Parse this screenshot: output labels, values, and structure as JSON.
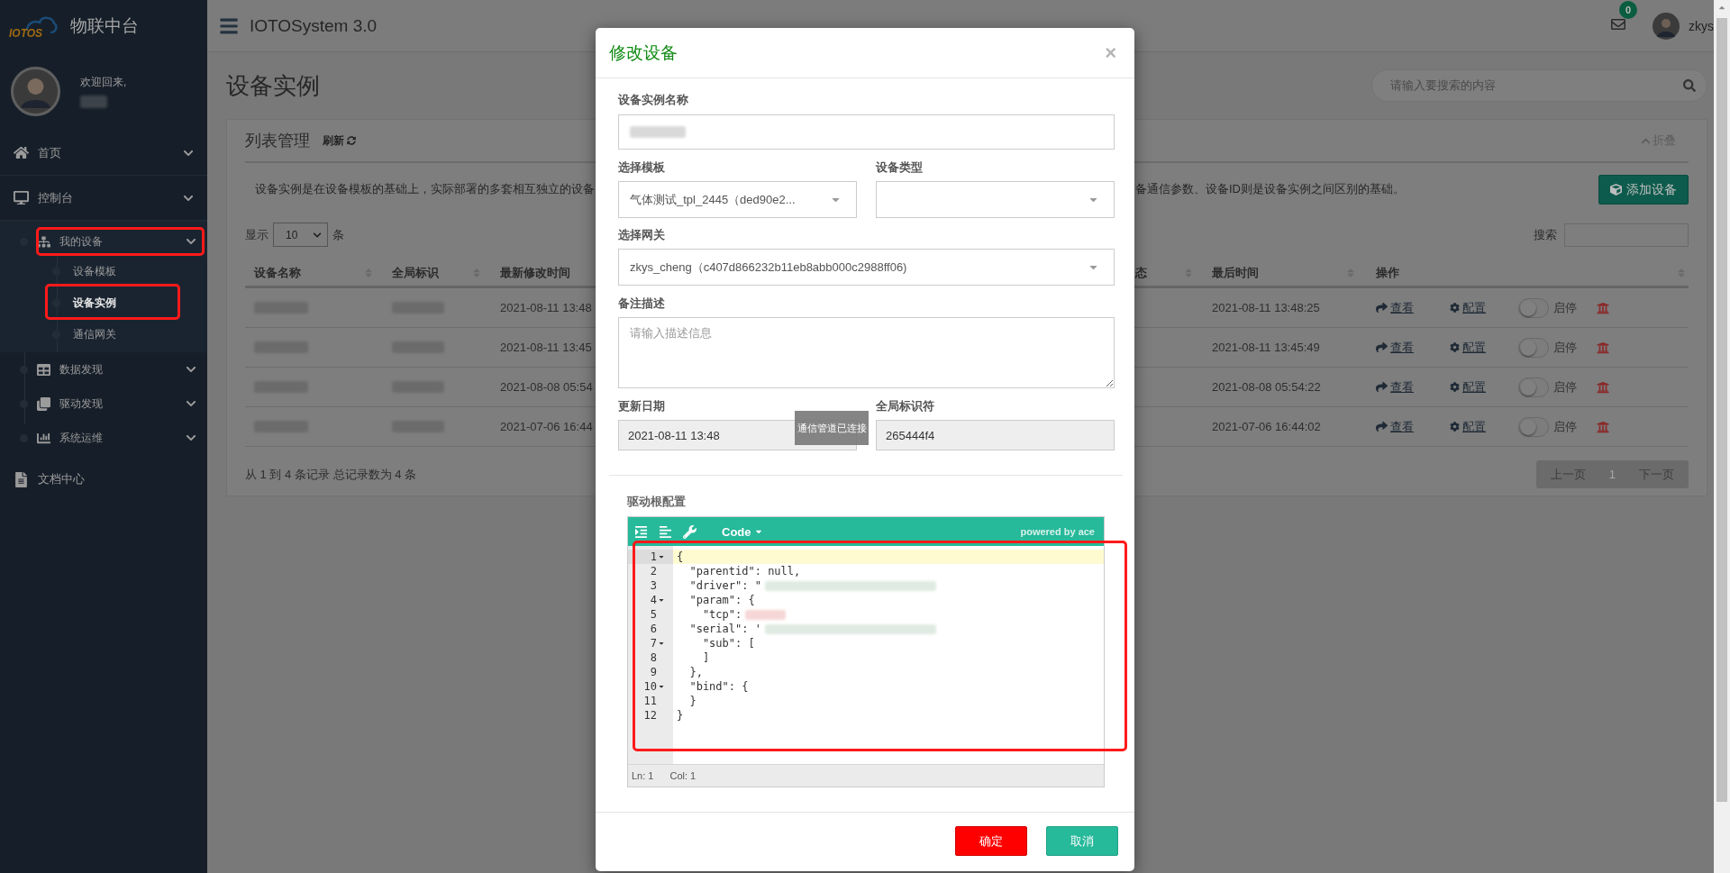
{
  "sidebar": {
    "logo_text": "IOTOS",
    "title": "物联中台",
    "welcome": "欢迎回来,",
    "user_redacted": true,
    "items": [
      {
        "label": "首页",
        "kind": "menu",
        "selected": false
      },
      {
        "label": "控制台",
        "kind": "menu",
        "selected": false,
        "expanded": true,
        "children": [
          {
            "label": "我的设备",
            "kind": "menu",
            "selected": false,
            "expanded": true,
            "highlighted": true,
            "children": [
              {
                "label": "设备模板",
                "selected": false,
                "highlighted": false
              },
              {
                "label": "设备实例",
                "selected": true,
                "highlighted": true
              },
              {
                "label": "通信网关",
                "selected": false,
                "highlighted": false
              }
            ]
          },
          {
            "label": "数据发现",
            "kind": "menu",
            "selected": false,
            "highlighted": false
          },
          {
            "label": "驱动发现",
            "kind": "menu",
            "selected": false,
            "highlighted": false
          },
          {
            "label": "系统运维",
            "kind": "menu",
            "selected": false,
            "highlighted": false
          }
        ]
      },
      {
        "label": "文档中心",
        "kind": "link",
        "selected": false
      }
    ]
  },
  "topbar": {
    "title": "IOTOSystem 3.0",
    "mail_count": "0",
    "username": "zkys"
  },
  "page": {
    "title": "设备实例",
    "search_placeholder": "请输入要搜索的内容"
  },
  "panel": {
    "title": "列表管理",
    "refresh": "刷新",
    "collapse": "折叠",
    "description_left": "设备实例是在设备模板的基础上，实际部署的多套相互独立的设备",
    "description_right": "备通信参数、设备ID则是设备实例之间区别的基础。",
    "add_button": "添加设备",
    "length_before": "显示",
    "length_value": "10",
    "length_after": "条",
    "search_label": "搜索",
    "columns": [
      {
        "label": "设备名称",
        "sortable": true
      },
      {
        "label": "全局标识",
        "sortable": true
      },
      {
        "label": "最新修改时间"
      },
      {
        "label": "态",
        "sortable": true
      },
      {
        "label": "最后时间",
        "sortable": true
      },
      {
        "label": "操作",
        "sortable": true
      }
    ],
    "rows": [
      {
        "name_redacted": true,
        "id_redacted": true,
        "modified": "2021-08-11 13:48",
        "last_time": "2021-08-11 13:48:25",
        "view": "查看",
        "config": "配置",
        "on": false,
        "toggle_label": "启停"
      },
      {
        "name_redacted": true,
        "id_redacted": true,
        "modified": "2021-08-11 13:45",
        "last_time": "2021-08-11 13:45:49",
        "view": "查看",
        "config": "配置",
        "on": false,
        "toggle_label": "启停"
      },
      {
        "name_redacted": true,
        "id_redacted": true,
        "modified": "2021-08-08 05:54",
        "last_time": "2021-08-08 05:54:22",
        "view": "查看",
        "config": "配置",
        "on": false,
        "toggle_label": "启停"
      },
      {
        "name_redacted": true,
        "id_redacted": true,
        "modified": "2021-07-06 16:44",
        "last_time": "2021-07-06 16:44:02",
        "view": "查看",
        "config": "配置",
        "on": false,
        "toggle_label": "启停"
      }
    ],
    "info": "从 1 到 4 条记录 总记录数为 4 条",
    "pagination": {
      "prev": "上一页",
      "page": "1",
      "next": "下一页"
    }
  },
  "modal": {
    "title": "修改设备",
    "close": "×",
    "name_label": "设备实例名称",
    "name_redacted": true,
    "template_label": "选择模板",
    "template_value": "气体测试_tpl_2445（ded90e2...",
    "type_label": "设备类型",
    "gateway_label": "选择网关",
    "gateway_value": "zkys_cheng（c407d866232b11eb8abb000c2988ff06)",
    "desc_label": "备注描述",
    "desc_placeholder": "请输入描述信息",
    "date_label": "更新日期",
    "date_value": "2021-08-11 13:48",
    "guid_label": "全局标识符",
    "guid_value": "265444f4",
    "toast": "通信管道已连接",
    "editor": {
      "label": "驱动根配置",
      "mode": "Code",
      "powered": "powered by ace",
      "highlighted": true,
      "ln": "Ln: 1",
      "col": "Col: 1",
      "lines": [
        {
          "no": "1",
          "text": "{",
          "fold": true,
          "active": true,
          "redacted": false
        },
        {
          "no": "2",
          "text": "  \"parentid\": null,",
          "fold": false,
          "active": false,
          "redacted": false
        },
        {
          "no": "3",
          "text": "  \"driver\": \"",
          "fold": false,
          "active": false,
          "redacted": true
        },
        {
          "no": "4",
          "text": "  \"param\": {",
          "fold": true,
          "active": false,
          "redacted": false
        },
        {
          "no": "5",
          "text": "    \"tcp\":",
          "fold": false,
          "active": false,
          "redacted": true
        },
        {
          "no": "6",
          "text": "  \"serial\": '",
          "fold": false,
          "active": false,
          "redacted": true
        },
        {
          "no": "7",
          "text": "    \"sub\": [",
          "fold": true,
          "active": false,
          "redacted": false
        },
        {
          "no": "8",
          "text": "    ]",
          "fold": false,
          "active": false,
          "redacted": false
        },
        {
          "no": "9",
          "text": "  },",
          "fold": false,
          "active": false,
          "redacted": false
        },
        {
          "no": "10",
          "text": "  \"bind\": {",
          "fold": true,
          "active": false,
          "redacted": false
        },
        {
          "no": "11",
          "text": "  }",
          "fold": false,
          "active": false,
          "redacted": false
        },
        {
          "no": "12",
          "text": "}",
          "fold": false,
          "active": false,
          "redacted": false
        }
      ]
    },
    "buttons": [
      {
        "label": "确定",
        "kind": "primary"
      },
      {
        "label": "取消",
        "kind": "secondary"
      }
    ]
  }
}
